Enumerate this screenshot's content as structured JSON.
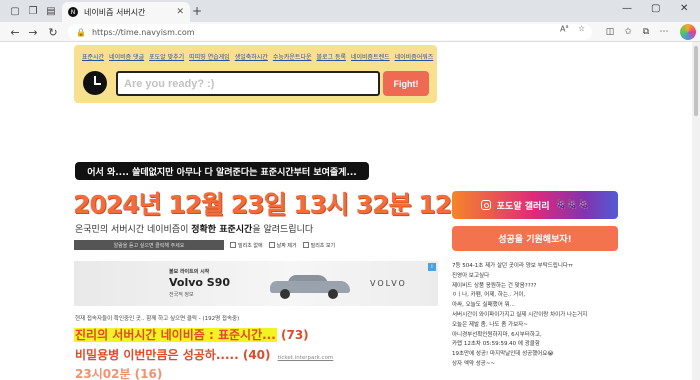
{
  "browser": {
    "tab_title": "네이비즘 서버시간",
    "tab_favicon": "N",
    "url": "https://time.navyism.com",
    "addr_icons": [
      "read-aloud-icon",
      "favorite-star-icon"
    ],
    "tool_icons": [
      "split-screen-icon",
      "favorites-icon",
      "collections-icon",
      "browser-extensions-icon",
      "more-icon"
    ]
  },
  "top_links": [
    "표준시간",
    "네이비즘 댓글",
    "포도알 맞추기",
    "띠띠띵 연습게임",
    "생일축하시간",
    "수능카운트다운",
    "블로그 등록",
    "네이비즘트렌드",
    "네이비즘어워즈"
  ],
  "answer_box": {
    "placeholder": "Are you ready? :)",
    "button": "Fight!"
  },
  "banner": {
    "text": "어서 와.... 쓸데없지만 아무나 다 알려준다는 표준시간부터 보여줄게..."
  },
  "server_time": "2024년 12월 23일 13시 32분 12초",
  "desc": {
    "pre": "온국민의 서버시간 네이비즘이 ",
    "bold": "정확한 표준시간",
    "post": "을 알려드립니다"
  },
  "options": {
    "dark_label": "알람을 듣고 싶으면 클릭해 주세요",
    "checks": [
      "밀리초 없애",
      "날짜 제거",
      "밀리초 보기"
    ]
  },
  "ad": {
    "small": "볼보 라이트의 시작",
    "title": "Volvo S90",
    "sub": "전국적 정보",
    "brand": "VOLVO",
    "badge": "i"
  },
  "live_note": "현재 접속자들이 확인중인 곳.. 함께 하고 싶으면 클릭 - (192명 접속중)",
  "entries": [
    {
      "title": "진리의 서버시간 네이비즘 : 표준시간...",
      "count": "(73)"
    },
    {
      "title": "비밀용병 이번만큼은 성공하.....",
      "count": "(40)",
      "source": "ticket.interpark.com"
    },
    {
      "title": "23시02분",
      "count": "(16)"
    }
  ],
  "sidebar": {
    "gallery": "포도알 갤러리",
    "gallery_emoji": "🍇🍇🍇",
    "cheer": "성공을 기원해보자!"
  },
  "chat": [
    "7등 504-1초 제가 살던 곳이라 양보 부탁드립니다ㅠ",
    "진영아 보고싶다",
    "제이비드 상품 응원하는 건 맞음????",
    "ㅇㅣ나, 카펜, 어제, 하는.. 거이,",
    "아싸, 오늘도 실패했어 뭐...",
    "서버시간이 와이파이가지고 실제 시간이랑 차이가 나는거지",
    "오늘은 제발 좀, 나도 좀 가보자~",
    "아니경부선확인원하지마, 6시부터하고,",
    "카랩 12초차 05:59:59.40 에 광클함",
    "19초만에 성공! 마지막날인데 성공했어요😭",
    "상자 엑약 성공~~"
  ]
}
